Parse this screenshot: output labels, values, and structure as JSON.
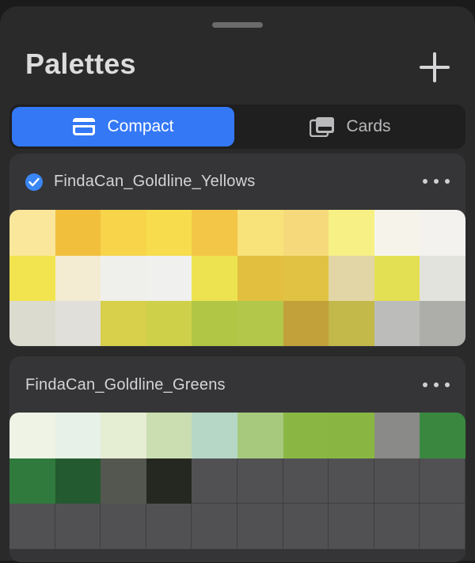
{
  "header": {
    "title": "Palettes",
    "add_icon": "plus-icon"
  },
  "view_toggle": {
    "options": [
      {
        "label": "Compact",
        "icon": "compact-card-icon",
        "active": true
      },
      {
        "label": "Cards",
        "icon": "cards-stack-icon",
        "active": false
      }
    ],
    "accent": "#3478f6"
  },
  "palettes": [
    {
      "name": "FindaCan_Goldline_Yellows",
      "selected": true,
      "swatches": [
        "#fbe79b",
        "#f2bf3c",
        "#f7d44a",
        "#f7dd4d",
        "#f4c647",
        "#f8e27a",
        "#f6d97b",
        "#f7f185",
        "#f6f4ea",
        "#f3f2ee",
        "#f1e44e",
        "#f4ecd2",
        "#efefeb",
        "#f0f0ee",
        "#ede351",
        "#e2bf3f",
        "#e2c242",
        "#e3d6a6",
        "#e4e053",
        "#e3e3de",
        "#dcdbcf",
        "#e0dfda",
        "#d8cf4a",
        "#cfd04a",
        "#b1c645",
        "#b3c84a",
        "#c2a13b",
        "#c3b84a",
        "#bcbdbb",
        "#adadaa"
      ]
    },
    {
      "name": "FindaCan_Goldline_Greens",
      "selected": false,
      "swatches": [
        "#eef3e5",
        "#e7f1e8",
        "#e5edd3",
        "#cadeb1",
        "#b6d6c6",
        "#a6c97d",
        "#8ab744",
        "#89b642",
        "#8a8b88",
        "#3a8840",
        "#2f7a3c",
        "#245a2f",
        "#54574f",
        "#242821",
        "",
        "",
        "",
        "",
        "",
        "",
        "",
        "",
        "",
        "",
        "",
        "",
        "",
        "",
        "",
        ""
      ]
    }
  ]
}
